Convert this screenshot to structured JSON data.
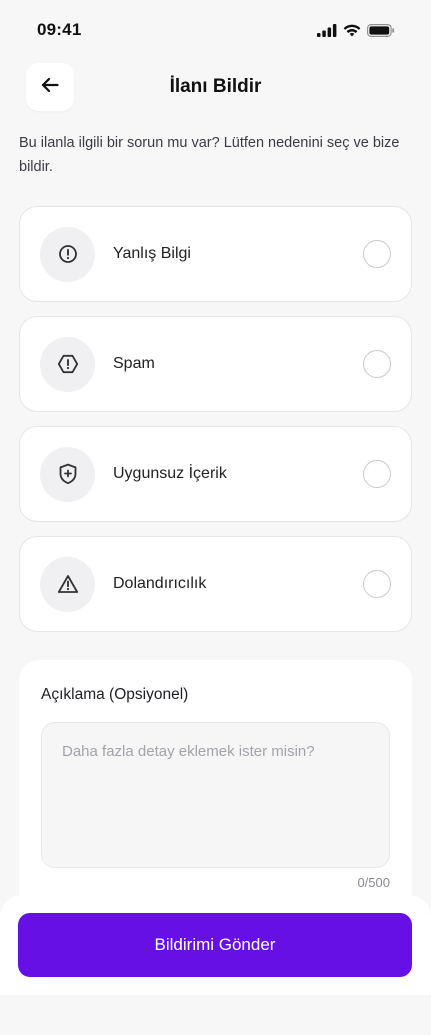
{
  "status_bar": {
    "time": "09:41"
  },
  "header": {
    "title": "İlanı Bildir"
  },
  "description": "Bu ilanla ilgili bir sorun mu var? Lütfen nedenini seç ve bize bildir.",
  "options": [
    {
      "label": "Yanlış Bilgi",
      "icon": "alert-circle-icon"
    },
    {
      "label": "Spam",
      "icon": "alert-octagon-icon"
    },
    {
      "label": "Uygunsuz İçerik",
      "icon": "shield-plus-icon"
    },
    {
      "label": "Dolandırıcılık",
      "icon": "warning-triangle-icon"
    }
  ],
  "details": {
    "label": "Açıklama (Opsiyonel)",
    "placeholder": "Daha fazla detay eklemek ister misin?",
    "value": "",
    "char_count": "0/500"
  },
  "footer": {
    "submit_label": "Bildirimi Gönder"
  },
  "colors": {
    "accent": "#6610e6",
    "background": "#f7f7f8"
  }
}
